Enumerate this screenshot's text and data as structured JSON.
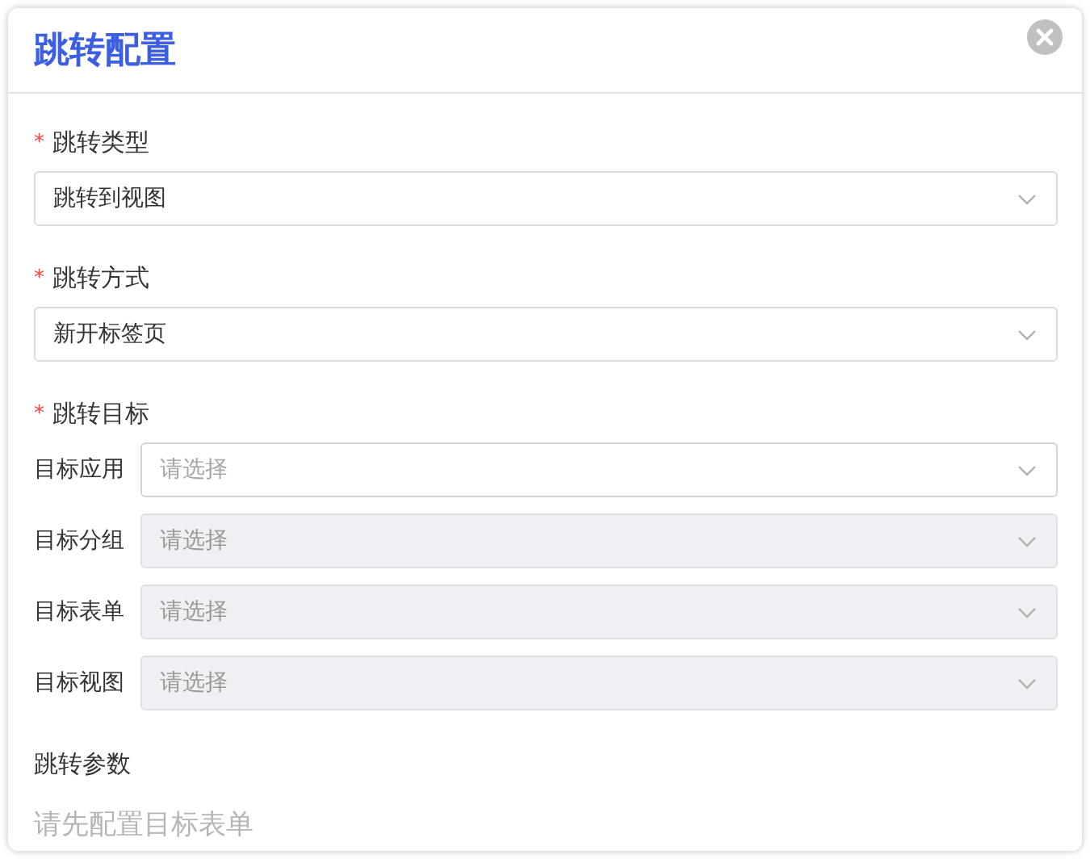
{
  "dialog": {
    "title": "跳转配置"
  },
  "fields": [
    {
      "label": "跳转类型",
      "required_mark": "*",
      "value": "跳转到视图"
    },
    {
      "label": "跳转方式",
      "required_mark": "*",
      "value": "新开标签页"
    }
  ],
  "target": {
    "label": "跳转目标",
    "required_mark": "*",
    "rows": [
      {
        "label": "目标应用",
        "placeholder": "请选择",
        "disabled": false
      },
      {
        "label": "目标分组",
        "placeholder": "请选择",
        "disabled": true
      },
      {
        "label": "目标表单",
        "placeholder": "请选择",
        "disabled": true
      },
      {
        "label": "目标视图",
        "placeholder": "请选择",
        "disabled": true
      }
    ]
  },
  "params": {
    "label": "跳转参数",
    "hint": "请先配置目标表单"
  }
}
